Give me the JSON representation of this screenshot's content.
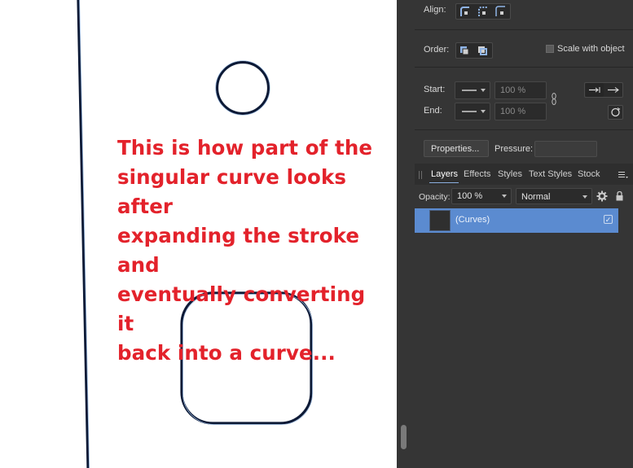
{
  "annotation": {
    "lines": [
      "This is how part of the",
      "singular curve looks after",
      "expanding the stroke and",
      "eventually converting it",
      "back into a curve..."
    ]
  },
  "colors": {
    "annotation_text": "#e3222b",
    "curve_stroke": "#0d1a36",
    "curve_outline": "#9fbde3",
    "panel_bg": "#353535",
    "selection": "#5b8bd0"
  },
  "stroke_panel": {
    "align_label": "Align:",
    "order_label": "Order:",
    "scale_with_object_label": "Scale with object",
    "start_label": "Start:",
    "end_label": "End:",
    "start_percent": "100 %",
    "end_percent": "100 %",
    "properties_button": "Properties...",
    "pressure_label": "Pressure:"
  },
  "layers_panel": {
    "tabs": [
      "Layers",
      "Effects",
      "Styles",
      "Text Styles",
      "Stock"
    ],
    "opacity_label": "Opacity:",
    "opacity_value": "100 %",
    "blend_mode": "Normal",
    "layers": [
      {
        "name": "(Curves)",
        "visible": true,
        "selected": true
      }
    ]
  },
  "icons": {
    "grip": "grip-handle-icon",
    "menu": "panel-menu-icon",
    "settings": "gear-icon",
    "lock": "lock-icon",
    "link": "chain-link-icon",
    "swap": "swap-arrowheads-icon"
  }
}
